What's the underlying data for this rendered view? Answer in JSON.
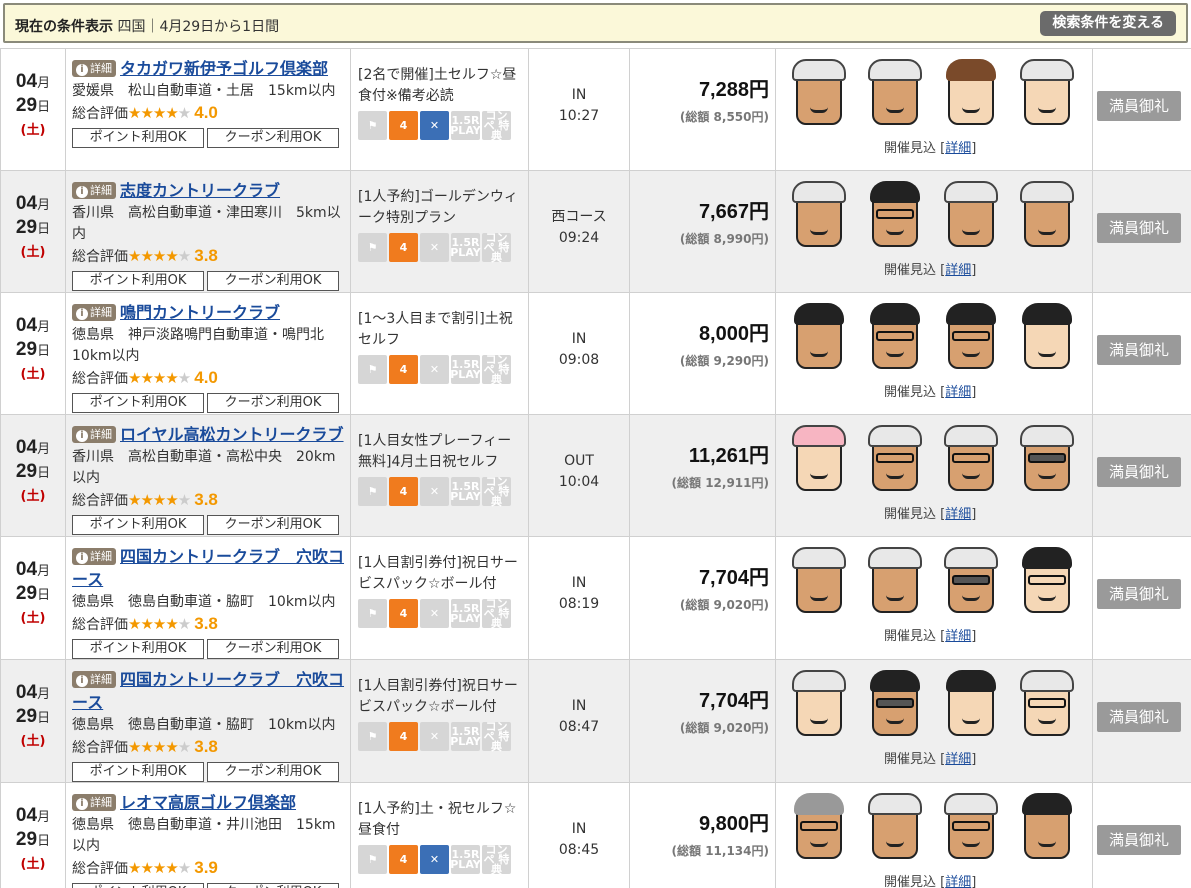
{
  "condition": {
    "label": "現在の条件表示",
    "text": "四国｜4月29日から1日間",
    "change_button": "検索条件を変える"
  },
  "ui": {
    "detail_badge": "詳細",
    "rating_prefix": "総合評価",
    "point_ok": "ポイント利用OK",
    "coupon_ok": "クーポン利用OK",
    "outlook": "開催見込",
    "outlook_link": "詳細",
    "month_unit": "月",
    "day_unit": "日",
    "yen": "円",
    "full": "満員御礼"
  },
  "colors": {
    "link": "#1a4b9b",
    "star": "#f39800",
    "sunday": "#c00000",
    "cart_on": "#f07b1e",
    "lunch_on": "#3b6fb6"
  },
  "rows": [
    {
      "month": "04",
      "day": "29",
      "dow": "(土)",
      "name": "タカガワ新伊予ゴルフ倶楽部",
      "location": "愛媛県　松山自動車道・土居　15km以内",
      "stars": 4,
      "score": "4.0",
      "plan": "[2名で開催]土セルフ☆昼食付※備考必読",
      "time_course": "IN",
      "time": "10:27",
      "price": "7,288",
      "total": "(総額 8,550円)",
      "lunch": true
    },
    {
      "month": "04",
      "day": "29",
      "dow": "(土)",
      "name": "志度カントリークラブ",
      "location": "香川県　高松自動車道・津田寒川　5km以内",
      "stars": 4,
      "score": "3.8",
      "plan": "[1人予約]ゴールデンウィーク特別プラン",
      "time_course": "西コース",
      "time": "09:24",
      "price": "7,667",
      "total": "(総額 8,990円)",
      "lunch": false
    },
    {
      "month": "04",
      "day": "29",
      "dow": "(土)",
      "name": "鳴門カントリークラブ",
      "location": "徳島県　神戸淡路鳴門自動車道・鳴門北 10km以内",
      "stars": 4,
      "score": "4.0",
      "plan": "[1～3人目まで割引]土祝セルフ",
      "time_course": "IN",
      "time": "09:08",
      "price": "8,000",
      "total": "(総額 9,290円)",
      "lunch": false
    },
    {
      "month": "04",
      "day": "29",
      "dow": "(土)",
      "name": "ロイヤル高松カントリークラブ",
      "location": "香川県　高松自動車道・高松中央　20km以内",
      "stars": 4,
      "score": "3.8",
      "plan": "[1人目女性プレーフィー無料]4月土日祝セルフ",
      "time_course": "OUT",
      "time": "10:04",
      "price": "11,261",
      "total": "(総額 12,911円)",
      "lunch": false
    },
    {
      "month": "04",
      "day": "29",
      "dow": "(土)",
      "name": "四国カントリークラブ　穴吹コース",
      "location": "徳島県　徳島自動車道・脇町　10km以内",
      "stars": 4,
      "score": "3.8",
      "plan": "[1人目割引券付]祝日サービスパック☆ボール付",
      "time_course": "IN",
      "time": "08:19",
      "price": "7,704",
      "total": "(総額 9,020円)",
      "lunch": false
    },
    {
      "month": "04",
      "day": "29",
      "dow": "(土)",
      "name": "四国カントリークラブ　穴吹コース",
      "location": "徳島県　徳島自動車道・脇町　10km以内",
      "stars": 4,
      "score": "3.8",
      "plan": "[1人目割引券付]祝日サービスパック☆ボール付",
      "time_course": "IN",
      "time": "08:47",
      "price": "7,704",
      "total": "(総額 9,020円)",
      "lunch": false
    },
    {
      "month": "04",
      "day": "29",
      "dow": "(土)",
      "name": "レオマ高原ゴルフ倶楽部",
      "location": "徳島県　徳島自動車道・井川池田　15km以内",
      "stars": 4,
      "score": "3.9",
      "plan": "[1人予約]土・祝セルフ☆昼食付",
      "time_course": "IN",
      "time": "08:45",
      "price": "9,800",
      "total": "(総額 11,134円)",
      "lunch": true
    }
  ],
  "avatars": [
    [
      "cap",
      "cap",
      "woman",
      "cap-old"
    ],
    [
      "cap",
      "hair-glasses",
      "cap",
      "cap"
    ],
    [
      "hair",
      "hair-glasses",
      "hair-glasses",
      "hair-light"
    ],
    [
      "woman-visor",
      "cap-glasses",
      "cap-glasses",
      "cap-sunglasses"
    ],
    [
      "cap",
      "cap",
      "cap-sunglasses",
      "hair-glasses-light"
    ],
    [
      "cap-old",
      "hair-sunglasses",
      "hair-light",
      "cap-glasses-light"
    ],
    [
      "gray-glasses",
      "cap",
      "cap-glasses",
      "hair"
    ]
  ],
  "plan_icons": [
    "caddie-icon",
    "cart-icon",
    "lunch-icon",
    "1.5R-play-icon",
    "compe-icon"
  ],
  "icon_text": {
    "cart": "4",
    "play": "1.5R PLAY",
    "compe": "コンペ 特典"
  }
}
